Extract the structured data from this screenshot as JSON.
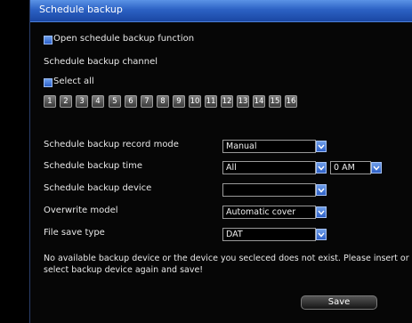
{
  "window": {
    "title": "Schedule backup"
  },
  "open_function": {
    "label": "Open schedule backup function",
    "checked": true
  },
  "channel_heading": "Schedule backup channel",
  "select_all": {
    "label": "Select all",
    "checked": true
  },
  "channels": [
    "1",
    "2",
    "3",
    "4",
    "5",
    "6",
    "7",
    "8",
    "9",
    "10",
    "11",
    "12",
    "13",
    "14",
    "15",
    "16"
  ],
  "settings": {
    "record_mode": {
      "label": "Schedule backup record mode",
      "value": "Manual"
    },
    "backup_time": {
      "label": "Schedule backup time",
      "value": "All",
      "time_value": "0 AM"
    },
    "backup_device": {
      "label": "Schedule backup device",
      "value": ""
    },
    "overwrite_model": {
      "label": "Overwrite model",
      "value": "Automatic cover"
    },
    "file_save_type": {
      "label": "File save type",
      "value": "DAT"
    }
  },
  "message": "No available backup device or the device you secleced does not exist. Please insert or select backup device again and save!",
  "save_label": "Save",
  "colors": {
    "title_bar": "#2c62c4",
    "accent": "#5b93e6",
    "background": "#060606"
  }
}
